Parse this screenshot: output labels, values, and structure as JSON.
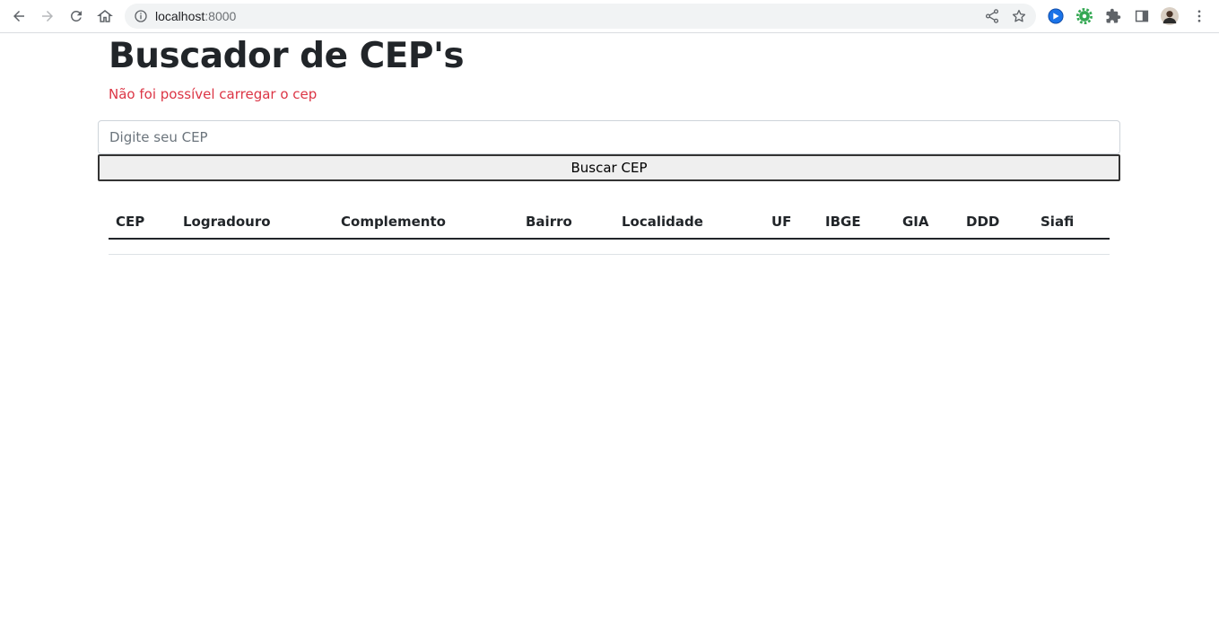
{
  "browser": {
    "url_host": "localhost",
    "url_port": ":8000"
  },
  "page": {
    "title": "Buscador de CEP's",
    "error_message": "Não foi possível carregar o cep",
    "input_placeholder": "Digite seu CEP",
    "input_value": "",
    "button_label": "Buscar CEP",
    "table_headers": [
      "CEP",
      "Logradouro",
      "Complemento",
      "Bairro",
      "Localidade",
      "UF",
      "IBGE",
      "GIA",
      "DDD",
      "Siafi"
    ]
  },
  "colors": {
    "error": "#dc3545",
    "text": "#212529"
  }
}
